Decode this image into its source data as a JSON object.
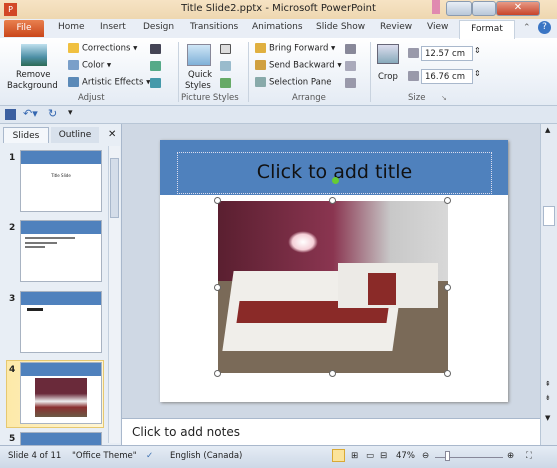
{
  "window": {
    "title": "Title Slide2.pptx  -  Microsoft PowerPoint"
  },
  "tabs": [
    {
      "label": "File"
    },
    {
      "label": "Home"
    },
    {
      "label": "Insert"
    },
    {
      "label": "Design"
    },
    {
      "label": "Transitions"
    },
    {
      "label": "Animations"
    },
    {
      "label": "Slide Show"
    },
    {
      "label": "Review"
    },
    {
      "label": "View"
    },
    {
      "label": "Format",
      "active": true
    }
  ],
  "ribbon": {
    "remove_bg_line1": "Remove",
    "remove_bg_line2": "Background",
    "corrections": "Corrections",
    "color": "Color",
    "artistic": "Artistic Effects",
    "adjust": "Adjust",
    "quick_line1": "Quick",
    "quick_line2": "Styles",
    "picture_styles": "Picture Styles",
    "bring_forward": "Bring Forward",
    "send_backward": "Send Backward",
    "selection_pane": "Selection Pane",
    "arrange": "Arrange",
    "crop": "Crop",
    "height": "12.57 cm",
    "width": "16.76 cm",
    "size": "Size"
  },
  "pane": {
    "tab_slides": "Slides",
    "tab_outline": "Outline",
    "slides": [
      {
        "num": "1",
        "text": "Title Slide"
      },
      {
        "num": "2"
      },
      {
        "num": "3"
      },
      {
        "num": "4",
        "selected": true
      },
      {
        "num": "5"
      }
    ]
  },
  "slide": {
    "title_placeholder": "Click to add title"
  },
  "notes": {
    "placeholder": "Click to add notes"
  },
  "status": {
    "slide": "Slide 4 of 11",
    "theme": "\"Office Theme\"",
    "language": "English (Canada)",
    "zoom": "47%",
    "zoom_percent": 47
  },
  "colors": {
    "accent": "#4f81bd",
    "file_tab": "#d55a2a"
  }
}
